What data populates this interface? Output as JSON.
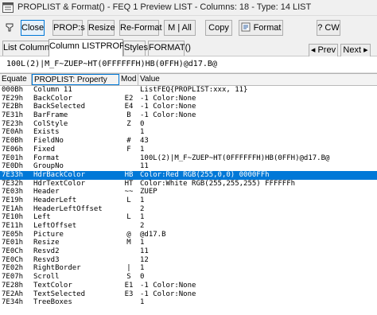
{
  "window": {
    "title": "PROPLIST & Format() - FEQ 1  Preview LIST - Columns: 18 - Type: 14 LIST"
  },
  "toolbar": {
    "close_label": "Close",
    "props_label": "PROP:s",
    "resize_label": "Resize",
    "reformat_label": "Re-Format",
    "mall_label": "M | All",
    "copy_label": "Copy",
    "format_label": "Format",
    "help_label": "? CW"
  },
  "tabs": [
    {
      "label": "List Columns"
    },
    {
      "label": "Column LISTPROP"
    },
    {
      "label": "Styles"
    },
    {
      "label": "FORMAT()"
    }
  ],
  "nav": {
    "prev_label": "Prev",
    "next_label": "Next"
  },
  "status_text": "100L(2)|M_F~ZUEP~HT(0FFFFFFH)HB(0FFH)@d17.B@",
  "grid": {
    "headers": [
      "Equate",
      "PROPLIST: Property",
      "Mod",
      "Value"
    ],
    "rows": [
      {
        "equate": "000Bh",
        "property": "  Column 11",
        "mod": "",
        "value": "ListFEQ{PROPLIST:xxx, 11}"
      },
      {
        "equate": "7E29h",
        "property": "BackColor",
        "mod": "E2",
        "value": "-1 Color:None"
      },
      {
        "equate": "7E2Bh",
        "property": "BackSelected",
        "mod": "E4",
        "value": "-1 Color:None"
      },
      {
        "equate": "7E31h",
        "property": "BarFrame",
        "mod": "B",
        "value": "-1 Color:None"
      },
      {
        "equate": "7E23h",
        "property": "ColStyle",
        "mod": "Z",
        "value": "0"
      },
      {
        "equate": "7E0Ah",
        "property": "Exists",
        "mod": "",
        "value": "1"
      },
      {
        "equate": "7E0Bh",
        "property": "FieldNo",
        "mod": "#",
        "value": "43"
      },
      {
        "equate": "7E06h",
        "property": "Fixed",
        "mod": "F",
        "value": "1"
      },
      {
        "equate": "7E01h",
        "property": "Format",
        "mod": "",
        "value": "100L(2)|M_F~ZUEP~HT(0FFFFFFH)HB(0FFH)@d17.B@"
      },
      {
        "equate": "7E0Dh",
        "property": "GroupNo",
        "mod": "",
        "value": "11"
      },
      {
        "equate": "7E33h",
        "property": "HdrBackColor",
        "mod": "HB",
        "value": "Color:Red  RGB(255,0,0)  0000FFh"
      },
      {
        "equate": "7E32h",
        "property": "HdrTextColor",
        "mod": "HT",
        "value": "Color:White  RGB(255,255,255)  FFFFFFh"
      },
      {
        "equate": "7E03h",
        "property": "Header",
        "mod": "~~",
        "value": "ZUEP"
      },
      {
        "equate": "7E19h",
        "property": "HeaderLeft",
        "mod": "L",
        "value": "1"
      },
      {
        "equate": "7E1Ah",
        "property": "HeaderLeftOffset",
        "mod": "",
        "value": "2"
      },
      {
        "equate": "7E10h",
        "property": "Left",
        "mod": "L",
        "value": "1"
      },
      {
        "equate": "7E11h",
        "property": "LeftOffset",
        "mod": "",
        "value": "2"
      },
      {
        "equate": "7E05h",
        "property": "Picture",
        "mod": "@",
        "value": "@d17.B"
      },
      {
        "equate": "7E01h",
        "property": "Resize",
        "mod": "M",
        "value": "1"
      },
      {
        "equate": "7E0Ch",
        "property": "Resvd2",
        "mod": "",
        "value": "11"
      },
      {
        "equate": "7E0Ch",
        "property": "Resvd3",
        "mod": "",
        "value": "12"
      },
      {
        "equate": "7E02h",
        "property": "RightBorder",
        "mod": "|",
        "value": "1"
      },
      {
        "equate": "7E07h",
        "property": "Scroll",
        "mod": "S",
        "value": "0"
      },
      {
        "equate": "7E28h",
        "property": "TextColor",
        "mod": "E1",
        "value": "-1 Color:None"
      },
      {
        "equate": "7E2Ah",
        "property": "TextSelected",
        "mod": "E3",
        "value": "-1 Color:None"
      },
      {
        "equate": "7E34h",
        "property": "TreeBoxes",
        "mod": "",
        "value": "1"
      }
    ],
    "selected_row": 10
  },
  "colors": {
    "selection": "#0078d7",
    "toolbar_bg": "#f0f0f0"
  }
}
